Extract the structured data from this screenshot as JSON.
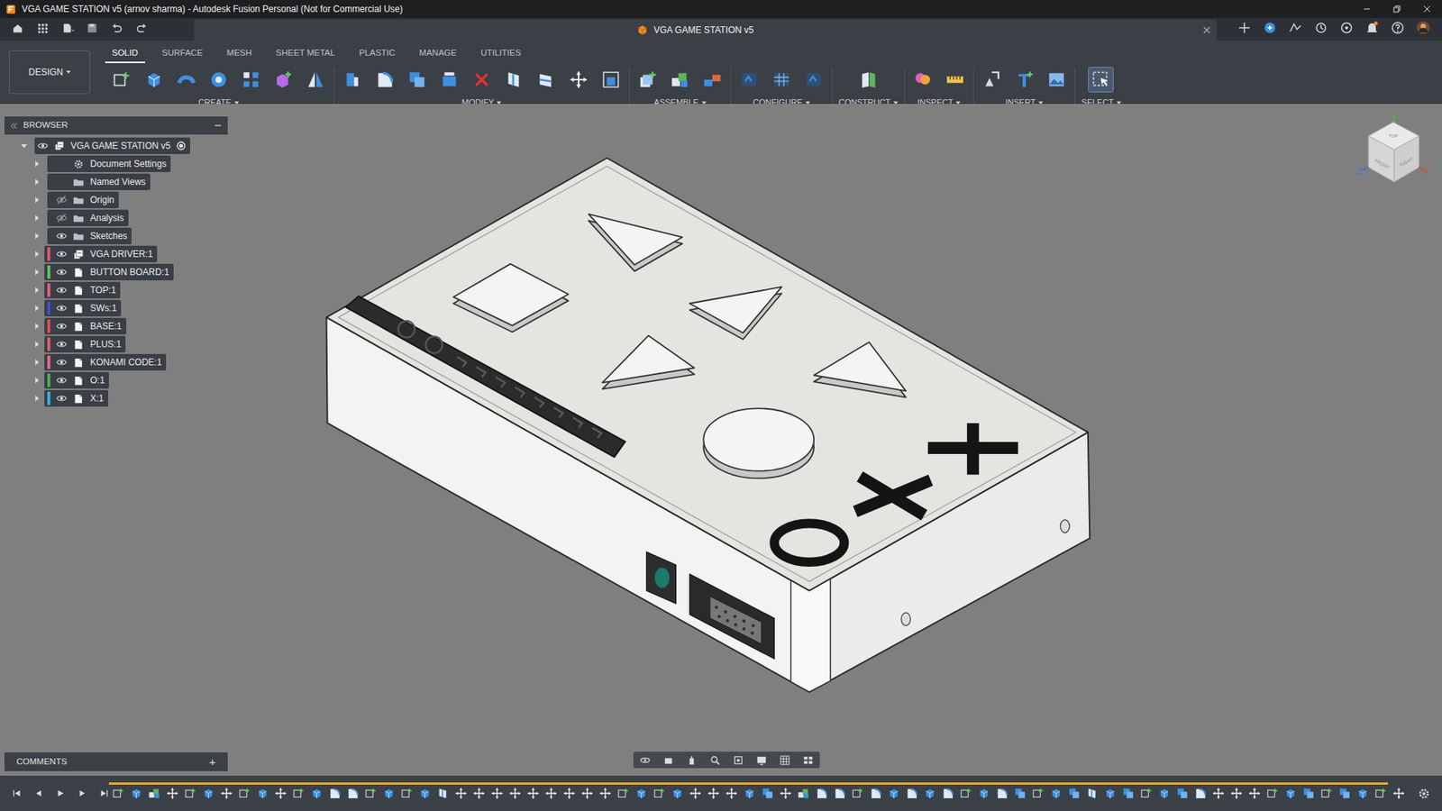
{
  "window": {
    "title": "VGA GAME STATION v5 (arnov sharma) - Autodesk Fusion Personal (Not for Commercial Use)"
  },
  "document_tab": {
    "title": "VGA GAME STATION v5",
    "selected": true
  },
  "toolbar": {
    "workspace": "DESIGN",
    "tabs": [
      {
        "label": "SOLID",
        "selected": true
      },
      {
        "label": "SURFACE",
        "selected": false
      },
      {
        "label": "MESH",
        "selected": false
      },
      {
        "label": "SHEET METAL",
        "selected": false
      },
      {
        "label": "PLASTIC",
        "selected": false
      },
      {
        "label": "MANAGE",
        "selected": false
      },
      {
        "label": "UTILITIES",
        "selected": false
      }
    ],
    "groups": [
      {
        "label": "CREATE",
        "highlighted": false,
        "tools": [
          "sketch",
          "extrude",
          "sweep",
          "hole",
          "pattern",
          "form",
          "mirror"
        ]
      },
      {
        "label": "MODIFY",
        "highlighted": false,
        "tools": [
          "pushpull",
          "fillet",
          "combine",
          "offset",
          "delete",
          "split",
          "cut",
          "move",
          "scale"
        ]
      },
      {
        "label": "ASSEMBLE",
        "highlighted": false,
        "tools": [
          "newcomp",
          "joint",
          "motion"
        ]
      },
      {
        "label": "CONFIGURE",
        "highlighted": false,
        "tools": [
          "config",
          "table",
          "config"
        ]
      },
      {
        "label": "CONSTRUCT",
        "highlighted": false,
        "tools": [
          "plane"
        ]
      },
      {
        "label": "INSPECT",
        "highlighted": false,
        "tools": [
          "inspect",
          "measure"
        ]
      },
      {
        "label": "INSERT",
        "highlighted": false,
        "tools": [
          "insert",
          "text",
          "image"
        ]
      },
      {
        "label": "SELECT",
        "highlighted": true,
        "tools": [
          "select"
        ]
      }
    ]
  },
  "browser": {
    "title": "BROWSER",
    "root": {
      "label": "VGA GAME STATION v5",
      "expanded": true,
      "visible": true,
      "active": true
    },
    "items": [
      {
        "label": "Document Settings",
        "kind": "settings",
        "visible": true,
        "expanded": false,
        "color": "#3a3e45"
      },
      {
        "label": "Named Views",
        "kind": "views",
        "visible": true,
        "expanded": false,
        "color": "#3a3e45"
      },
      {
        "label": "Origin",
        "kind": "folder",
        "visible": false,
        "expanded": false,
        "color": "#3a3e45"
      },
      {
        "label": "Analysis",
        "kind": "folder",
        "visible": false,
        "expanded": false,
        "color": "#3a3e45"
      },
      {
        "label": "Sketches",
        "kind": "folder",
        "visible": true,
        "expanded": false,
        "color": "#3a3e45"
      },
      {
        "label": "VGA DRIVER:1",
        "kind": "assembly",
        "visible": true,
        "expanded": false,
        "color": "#d9556f"
      },
      {
        "label": "BUTTON BOARD:1",
        "kind": "component",
        "visible": true,
        "expanded": false,
        "color": "#5cbf5c"
      },
      {
        "label": "TOP:1",
        "kind": "component",
        "visible": true,
        "expanded": false,
        "color": "#e0607e"
      },
      {
        "label": "SWs:1",
        "kind": "component",
        "visible": true,
        "expanded": false,
        "color": "#3f4fd0"
      },
      {
        "label": "BASE:1",
        "kind": "component",
        "visible": true,
        "expanded": false,
        "color": "#d94f4f"
      },
      {
        "label": "PLUS:1",
        "kind": "component",
        "visible": true,
        "expanded": false,
        "color": "#e05a72"
      },
      {
        "label": "KONAMI CODE:1",
        "kind": "component",
        "visible": true,
        "expanded": false,
        "color": "#e06a86"
      },
      {
        "label": "O:1",
        "kind": "component",
        "visible": true,
        "expanded": false,
        "color": "#4caf50"
      },
      {
        "label": "X:1",
        "kind": "component",
        "visible": true,
        "expanded": false,
        "color": "#2fb3d6"
      }
    ]
  },
  "view_cube": {
    "faces": [
      "TOP",
      "FRONT",
      "RIGHT"
    ],
    "axes": [
      {
        "label": "Z",
        "color": "#3a6fe0"
      },
      {
        "label": "X",
        "color": "#e04040"
      }
    ]
  },
  "comments": {
    "title": "COMMENTS",
    "add": "+"
  },
  "timeline": {
    "features": [
      "sketch",
      "extrude",
      "joint",
      "move",
      "sketch",
      "extrude",
      "move",
      "sketch",
      "extrude",
      "move",
      "sketch",
      "extrude",
      "fillet",
      "fillet",
      "sketch",
      "extrude",
      "sketch",
      "extrude",
      "split",
      "move",
      "move",
      "move",
      "move",
      "move",
      "move",
      "move",
      "move",
      "move",
      "sketch",
      "extrude",
      "sketch",
      "extrude",
      "move",
      "move",
      "move",
      "extrude",
      "combine",
      "move",
      "joint",
      "fillet",
      "fillet",
      "sketch",
      "fillet",
      "extrude",
      "fillet",
      "extrude",
      "fillet",
      "sketch",
      "extrude",
      "fillet",
      "combine",
      "sketch",
      "extrude",
      "combine",
      "split",
      "extrude",
      "combine",
      "sketch",
      "extrude",
      "combine",
      "fillet",
      "move",
      "move",
      "move",
      "sketch",
      "extrude",
      "combine",
      "sketch",
      "combine",
      "extrude",
      "sketch",
      "move"
    ]
  }
}
